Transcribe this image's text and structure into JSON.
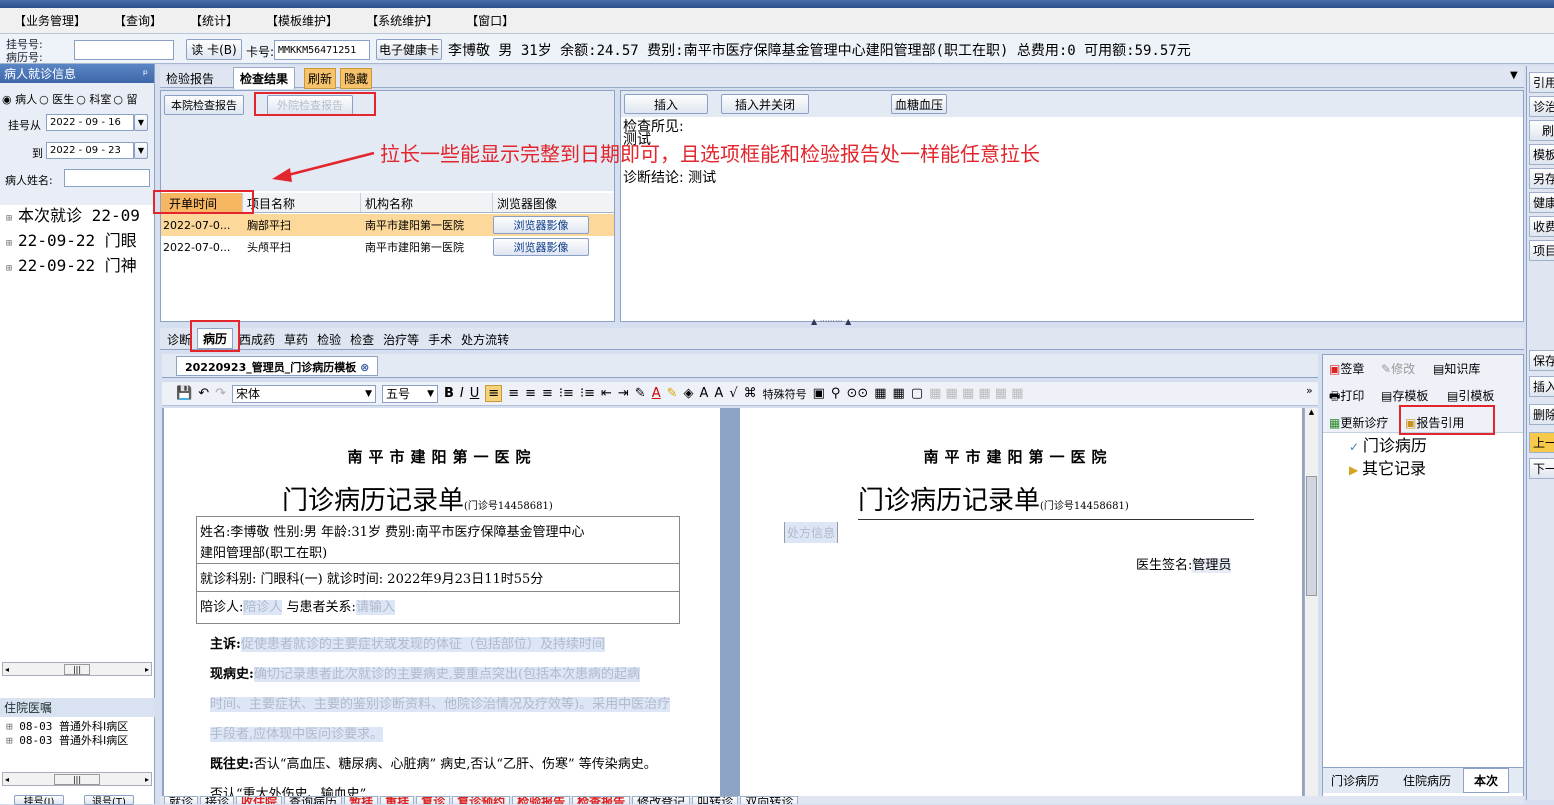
{
  "menu": [
    "【业务管理】",
    "【查询】",
    "【统计】",
    "【模板维护】",
    "【系统维护】",
    "【窗口】"
  ],
  "patient_bar": {
    "reg_no_label": "挂号号:",
    "record_no_label": "病历号:",
    "read_card_button": "读 卡(B)",
    "card_no_label": "卡号:",
    "card_no_value": "MMKKM56471251",
    "health_card_button": "电子健康卡",
    "info": "李博敬  男  31岁  余额:24.57  费别:南平市医疗保障基金管理中心建阳管理部(职工在职) 总费用:0  可用额:59.57元"
  },
  "left_panel": {
    "header": "病人就诊信息",
    "pin": "ᵖ",
    "radio_options": [
      "病人",
      "医生",
      "科室",
      "留"
    ],
    "reg_from_label": "挂号从",
    "reg_from_value": "2022 - 09 - 16",
    "reg_to_label": "到",
    "reg_to_value": "2022 - 09 - 23",
    "patient_name_label": "病人姓名:",
    "tree": [
      "本次就诊  22-09",
      "22-09-22  门眼",
      "22-09-22  门神"
    ],
    "inpatient_header": "住院医嘱",
    "inpatient_items": [
      "08-03  普通外科Ⅰ病区",
      "08-03  普通外科Ⅰ病区"
    ],
    "bottom_buttons": [
      "挂号(I)",
      "退号(T)"
    ]
  },
  "report_tabs": {
    "tabs": [
      "检验报告",
      "检查结果",
      "刷新",
      "隐藏"
    ],
    "sub_tabs": [
      "本院检查报告",
      "外院检查报告"
    ],
    "columns": [
      "开单时间",
      "项目名称",
      "机构名称",
      "浏览器图像"
    ],
    "rows": [
      {
        "time": "2022-07-0...",
        "item": "胸部平扫",
        "org": "南平市建阳第一医院",
        "img": "浏览器影像"
      },
      {
        "time": "2022-07-0...",
        "item": "头颅平扫",
        "org": "南平市建阳第一医院",
        "img": "浏览器影像"
      }
    ]
  },
  "annotation": "拉长一些能显示完整到日期即可，且选项框能和检验报告处一样能任意拉长",
  "result_panel": {
    "buttons": [
      "插入",
      "插入并关闭",
      "血糖血压"
    ],
    "finding_label": "检查所见:",
    "finding_value": "测试",
    "conclusion": "诊断结论: 测试"
  },
  "emr_tabs": [
    "诊断",
    "病历",
    "西成药",
    "草药",
    "检验",
    "检查",
    "治疗等",
    "手术",
    "处方流转"
  ],
  "doc_tab": "20220923_管理员_门诊病历模板",
  "toolbar": {
    "font": "宋体",
    "size": "五号",
    "special": "特殊符号"
  },
  "doc_left": {
    "hospital": "南平市建阳第一医院",
    "title": "门诊病历记录单",
    "visit_no": "(门诊号14458681)",
    "name_line": "姓名:李博敬    性别:男     年龄:31岁     费别:南平市医疗保障基金管理中心",
    "name_line2": "建阳管理部(职工在职)",
    "dept_line": "就诊科别: 门眼科(一)  就诊时间: 2022年9月23日11时55分",
    "companion_label": "陪诊人:",
    "companion_ph": "陪诊人",
    "relation_label": "与患者关系:",
    "relation_ph": "请输入",
    "complaint_label": "主诉:",
    "complaint_ph": "促使患者就诊的主要症状或发现的体征（包括部位）及持续时间",
    "history_label": "现病史:",
    "history_ph1": "确切记录患者此次就诊的主要病史,要重点突出(包括本次患病的起病",
    "history_ph2": "时间、主要症状、主要的鉴别诊断资料、他院诊治情况及疗效等)。采用中医治疗",
    "history_ph3": "手段者,应体现中医问诊要求。",
    "past_label": "既往史:",
    "past_value": "否认“高血压、糖尿病、心脏病” 病史,否认“乙肝、伤寒” 等传染病史。",
    "past_value2": "否认“重大外伤史、输血史”"
  },
  "doc_right": {
    "hospital": "南平市建阳第一医院",
    "title": "门诊病历记录单",
    "visit_no": "(门诊号14458681)",
    "rx_ph": "处方信息",
    "sign_label": "医生签名:",
    "sign_value": "管理员"
  },
  "right_tools": {
    "sign": "签章",
    "modify": "修改",
    "knowledge": "知识库",
    "print": "打印",
    "save_template": "存模板",
    "cite_template": "引模板",
    "update_diag": "更新诊疗",
    "report_cite": "报告引用",
    "tree": [
      "门诊病历",
      "其它记录"
    ],
    "bottom_tabs": [
      "门诊病历",
      "住院病历",
      "本次"
    ]
  },
  "far_right": [
    "引用",
    "诊治",
    "刷",
    "模板",
    "另存",
    "健康",
    "收费",
    "项目"
  ],
  "far_right2": [
    "保存",
    "插入",
    "删除",
    "上一",
    "下一"
  ],
  "bottom_bar": [
    "就诊",
    "接诊",
    "收住院",
    "查询病历",
    "暂挂",
    "重挂",
    "复诊",
    "复诊预约",
    "检验报告",
    "检查报告",
    "修改登记",
    "叫转诊",
    "双向转诊"
  ]
}
